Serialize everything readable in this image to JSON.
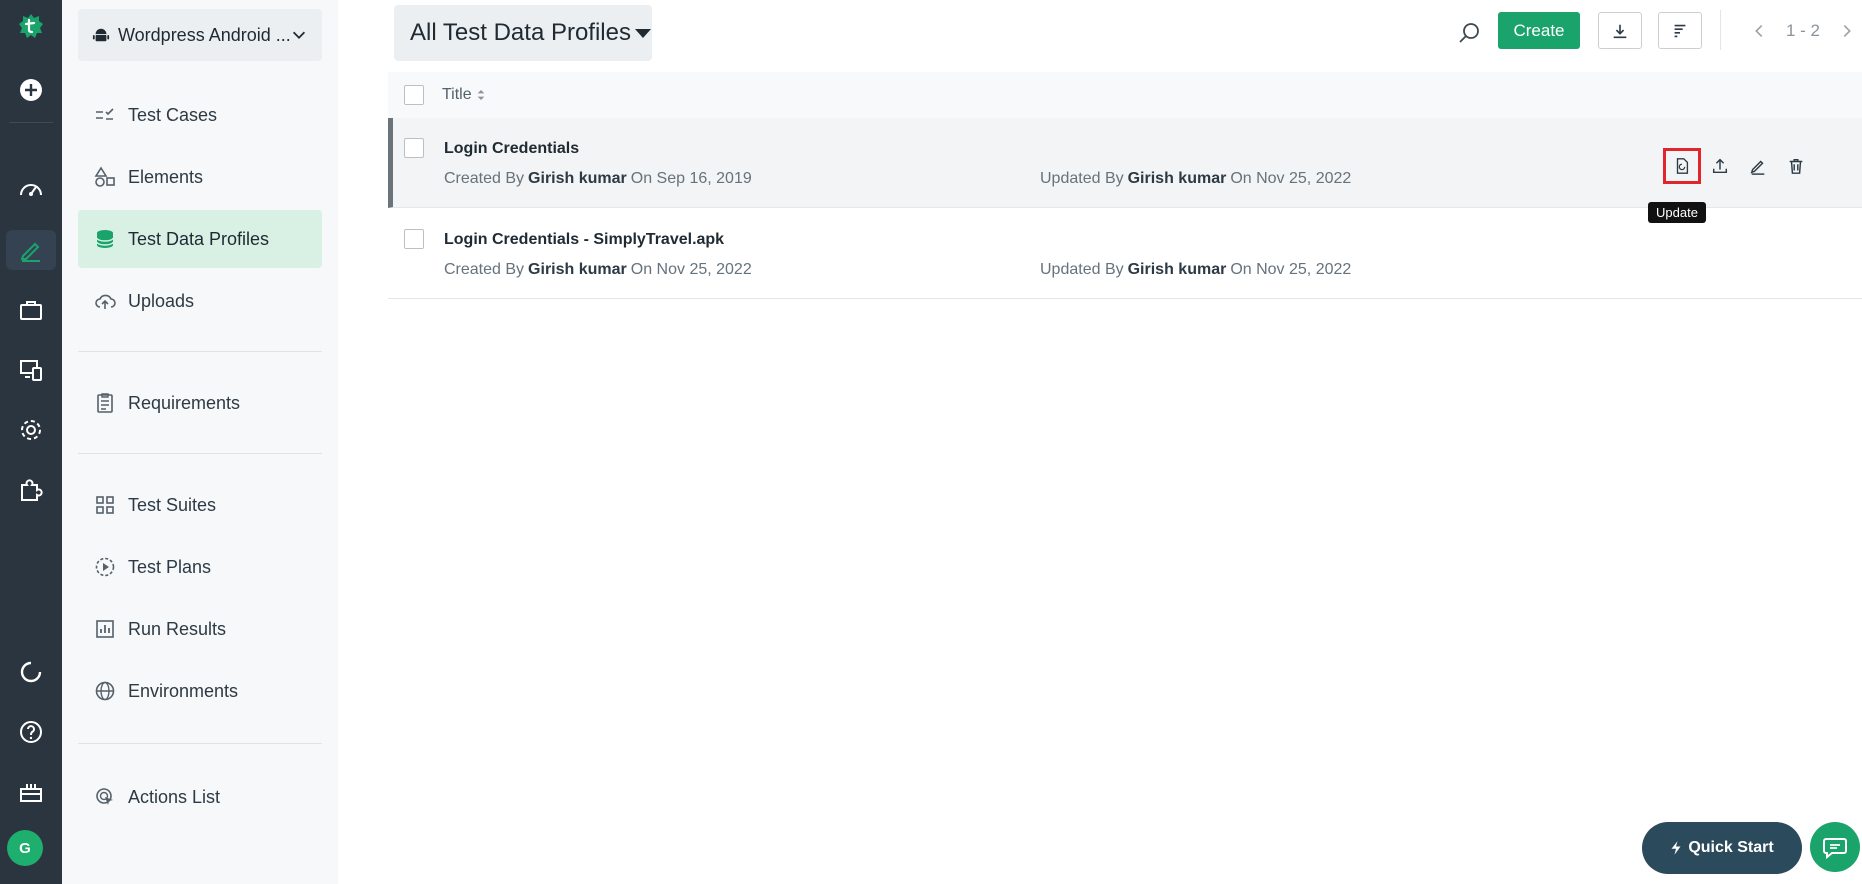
{
  "colors": {
    "accent": "#1aa46b",
    "rail_bg": "#2b3540",
    "nav_active_bg": "#d9f1e5",
    "highlight": "#e0262c"
  },
  "rail": {
    "icons": [
      "testsigma-logo-icon",
      "add-circle-icon",
      "dashboard-icon",
      "edit-pen-icon",
      "briefcase-icon",
      "devices-icon",
      "gear-icon",
      "puzzle-icon",
      "sync-icon",
      "help-icon",
      "gift-icon"
    ],
    "avatar_initial": "G"
  },
  "project": {
    "name": "Wordpress Android ..."
  },
  "nav": {
    "items": [
      {
        "label": "Test Cases",
        "icon": "test-cases-icon"
      },
      {
        "label": "Elements",
        "icon": "elements-icon"
      },
      {
        "label": "Test Data Profiles",
        "icon": "database-icon",
        "active": true
      },
      {
        "label": "Uploads",
        "icon": "cloud-upload-icon"
      },
      {
        "label": "Requirements",
        "icon": "clipboard-icon"
      },
      {
        "label": "Test Suites",
        "icon": "grid-icon"
      },
      {
        "label": "Test Plans",
        "icon": "play-circle-icon"
      },
      {
        "label": "Run Results",
        "icon": "bar-chart-icon"
      },
      {
        "label": "Environments",
        "icon": "globe-icon"
      },
      {
        "label": "Actions List",
        "icon": "cursor-icon"
      }
    ]
  },
  "toolbar": {
    "filter_label": "All Test Data Profiles",
    "create_label": "Create",
    "pager_label": "1 - 2"
  },
  "list": {
    "header_title": "Title",
    "rows": [
      {
        "title": "Login Credentials",
        "created_label": "Created By",
        "created_by": "Girish kumar",
        "created_on": "On Sep 16, 2019",
        "updated_label": "Updated By",
        "updated_by": "Girish kumar",
        "updated_on": "On Nov 25, 2022"
      },
      {
        "title": "Login Credentials - SimplyTravel.apk",
        "created_label": "Created By",
        "created_by": "Girish kumar",
        "created_on": "On Nov 25, 2022",
        "updated_label": "Updated By",
        "updated_by": "Girish kumar",
        "updated_on": "On Nov 25, 2022"
      }
    ],
    "tooltip": "Update"
  },
  "footer": {
    "quick_start_label": "Quick Start"
  }
}
